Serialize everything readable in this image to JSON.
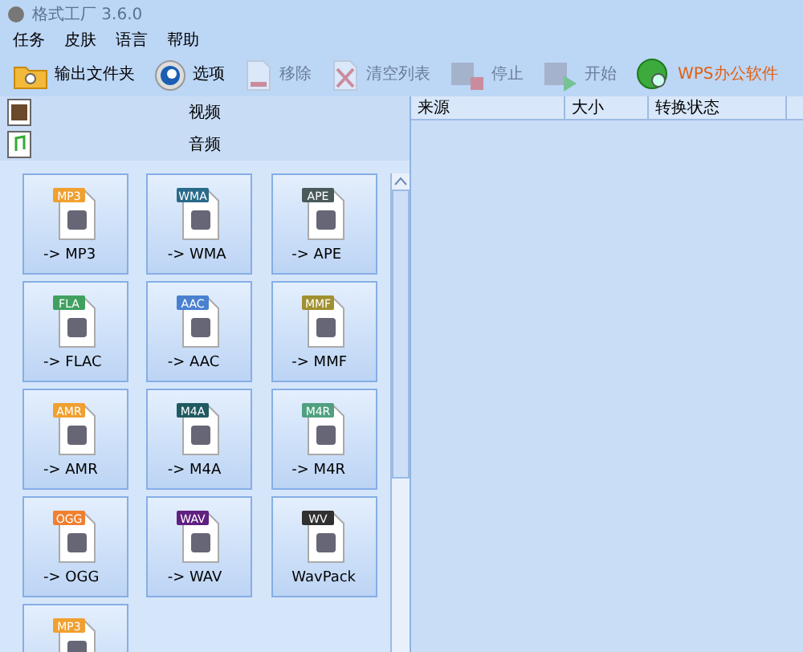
{
  "window": {
    "title": "格式工厂 3.6.0"
  },
  "menu": [
    "任务",
    "皮肤",
    "语言",
    "帮助"
  ],
  "toolbar": [
    {
      "label": "输出文件夹",
      "kind": "folder",
      "disabled": false
    },
    {
      "label": "选项",
      "kind": "options",
      "disabled": false
    },
    {
      "label": "移除",
      "kind": "remove",
      "disabled": true
    },
    {
      "label": "清空列表",
      "kind": "clear",
      "disabled": true
    },
    {
      "label": "停止",
      "kind": "stop",
      "disabled": true
    },
    {
      "label": "开始",
      "kind": "start",
      "disabled": true
    },
    {
      "label": "WPS办公软件",
      "kind": "globe",
      "disabled": false
    }
  ],
  "categories": [
    {
      "label": "视频",
      "kind": "video"
    },
    {
      "label": "音频",
      "kind": "audio"
    }
  ],
  "formats": [
    {
      "badge": "MP3",
      "label": "-> MP3",
      "color": "#f0a030"
    },
    {
      "badge": "WMA",
      "label": "-> WMA",
      "color": "#2a6a8a"
    },
    {
      "badge": "APE",
      "label": "-> APE",
      "color": "#4a5a5a"
    },
    {
      "badge": "FLA",
      "label": "-> FLAC",
      "color": "#40a060"
    },
    {
      "badge": "AAC",
      "label": "-> AAC",
      "color": "#4a80d0"
    },
    {
      "badge": "MMF",
      "label": "-> MMF",
      "color": "#a09030"
    },
    {
      "badge": "AMR",
      "label": "-> AMR",
      "color": "#f0a030"
    },
    {
      "badge": "M4A",
      "label": "-> M4A",
      "color": "#205a60"
    },
    {
      "badge": "M4R",
      "label": "-> M4R",
      "color": "#50a080"
    },
    {
      "badge": "OGG",
      "label": "-> OGG",
      "color": "#f08030"
    },
    {
      "badge": "WAV",
      "label": "-> WAV",
      "color": "#602080"
    },
    {
      "badge": "WV",
      "label": "WavPack",
      "color": "#303030"
    },
    {
      "badge": "MP3",
      "color": "#f0a030"
    }
  ],
  "table": {
    "columns": [
      "来源",
      "大小",
      "转换状态"
    ]
  }
}
